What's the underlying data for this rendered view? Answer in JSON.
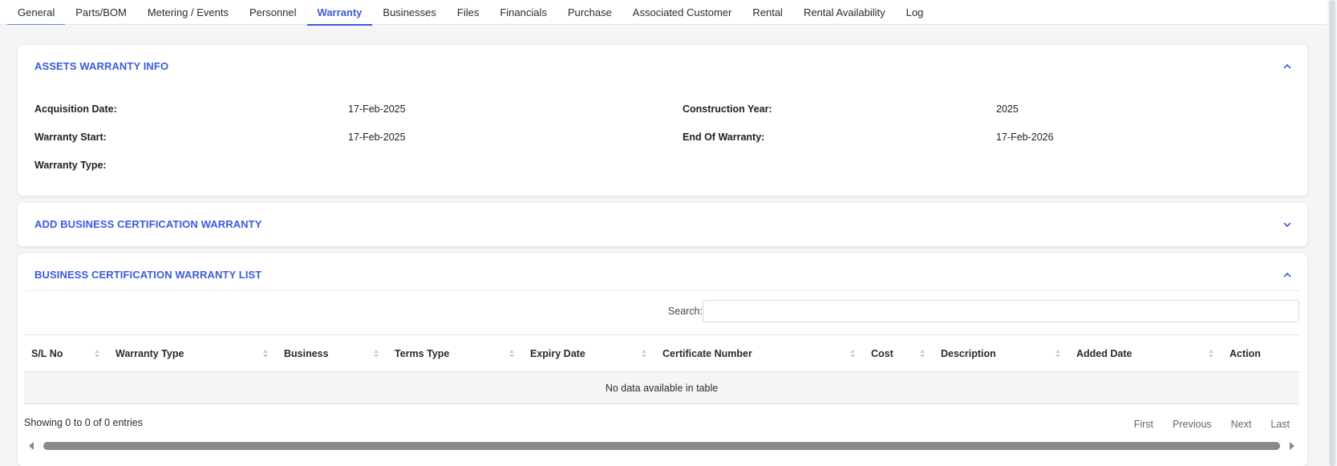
{
  "tabs": [
    {
      "label": "General"
    },
    {
      "label": "Parts/BOM"
    },
    {
      "label": "Metering / Events"
    },
    {
      "label": "Personnel"
    },
    {
      "label": "Warranty"
    },
    {
      "label": "Businesses"
    },
    {
      "label": "Files"
    },
    {
      "label": "Financials"
    },
    {
      "label": "Purchase"
    },
    {
      "label": "Associated Customer"
    },
    {
      "label": "Rental"
    },
    {
      "label": "Rental Availability"
    },
    {
      "label": "Log"
    }
  ],
  "active_tab": "Warranty",
  "colors": {
    "accent": "#3b5bdb"
  },
  "assets_warranty": {
    "title": "ASSETS WARRANTY INFO",
    "acquisition_date_label": "Acquisition Date:",
    "acquisition_date_value": "17-Feb-2025",
    "construction_year_label": "Construction Year:",
    "construction_year_value": "2025",
    "warranty_start_label": "Warranty Start:",
    "warranty_start_value": "17-Feb-2025",
    "end_of_warranty_label": "End Of Warranty:",
    "end_of_warranty_value": "17-Feb-2026",
    "warranty_type_label": "Warranty Type:",
    "warranty_type_value": ""
  },
  "add_certification": {
    "title": "ADD BUSINESS CERTIFICATION WARRANTY"
  },
  "cert_list": {
    "title": "BUSINESS CERTIFICATION WARRANTY LIST",
    "search_label": "Search:",
    "search_value": "",
    "columns": [
      "S/L No",
      "Warranty Type",
      "Business",
      "Terms Type",
      "Expiry Date",
      "Certificate Number",
      "Cost",
      "Description",
      "Added Date",
      "Action"
    ],
    "empty_message": "No data available in table",
    "info": "Showing 0 to 0 of 0 entries",
    "pager": {
      "first": "First",
      "previous": "Previous",
      "next": "Next",
      "last": "Last"
    }
  },
  "icons": {
    "collapse": "chevron-up-icon",
    "expand": "chevron-down-icon",
    "sort": "sort-icon"
  }
}
